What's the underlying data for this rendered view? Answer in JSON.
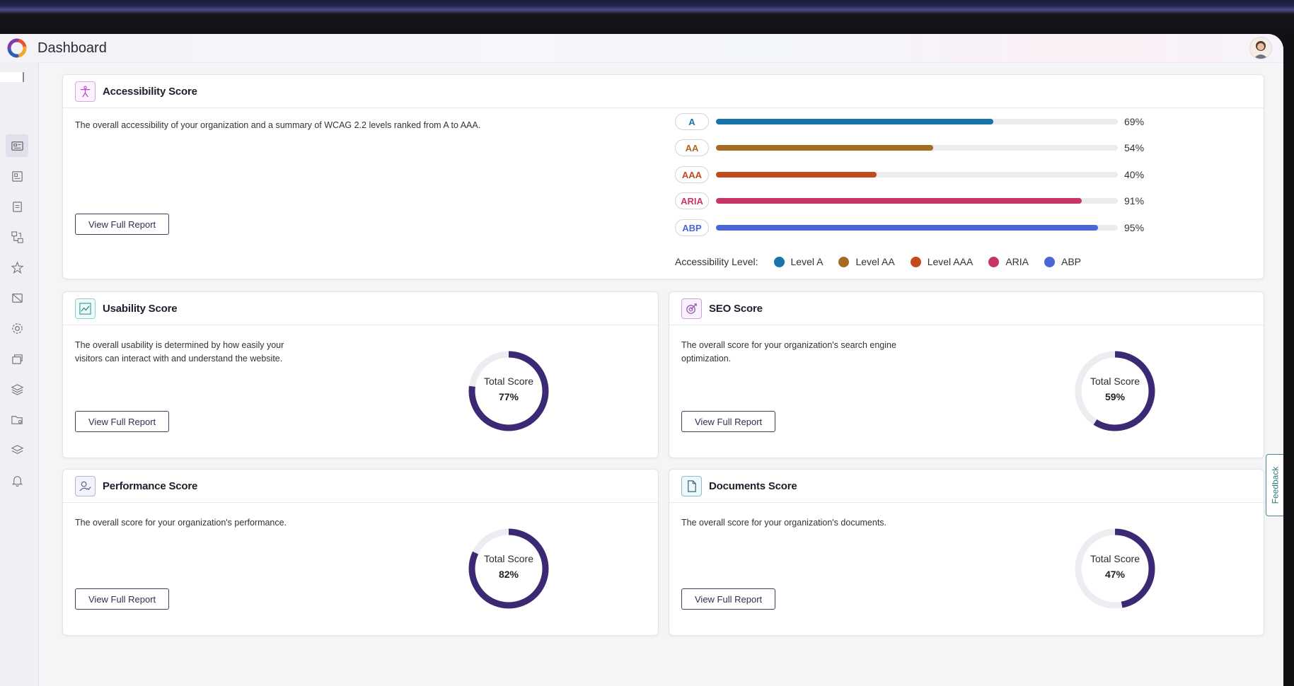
{
  "header": {
    "title": "Dashboard"
  },
  "sidebar": {
    "items": [
      {
        "icon": "dashboard-icon",
        "active": true
      },
      {
        "icon": "report-icon"
      },
      {
        "icon": "document-icon"
      },
      {
        "icon": "workflow-icon"
      },
      {
        "icon": "accessibility-icon"
      },
      {
        "icon": "image-off-icon"
      },
      {
        "icon": "gear-icon"
      },
      {
        "icon": "windows-icon"
      },
      {
        "icon": "layers-icon"
      },
      {
        "icon": "folder-settings-icon"
      },
      {
        "icon": "stack-icon"
      },
      {
        "icon": "bell-icon"
      }
    ]
  },
  "accessibility": {
    "title": "Accessibility Score",
    "description": "The overall accessibility of your organization and a summary of WCAG 2.2 levels ranked from A to AAA.",
    "button": "View Full Report",
    "levels": [
      {
        "label": "A",
        "percent_text": "69%",
        "value": 69,
        "color": "#1874a9"
      },
      {
        "label": "AA",
        "percent_text": "54%",
        "value": 54,
        "color": "#a86a22"
      },
      {
        "label": "AAA",
        "percent_text": "40%",
        "value": 40,
        "color": "#c24a1c"
      },
      {
        "label": "ARIA",
        "percent_text": "91%",
        "value": 91,
        "color": "#c93467"
      },
      {
        "label": "ABP",
        "percent_text": "95%",
        "value": 95,
        "color": "#4a67d6"
      }
    ],
    "legend_title": "Accessibility Level:",
    "legend": [
      {
        "label": "Level A",
        "color": "#1874a9"
      },
      {
        "label": "Level AA",
        "color": "#a86a22"
      },
      {
        "label": "Level AAA",
        "color": "#c24a1c"
      },
      {
        "label": "ARIA",
        "color": "#c93467"
      },
      {
        "label": "ABP",
        "color": "#4a67d6"
      }
    ]
  },
  "usability": {
    "title": "Usability Score",
    "description_line1": "The overall usability is determined by how easily your",
    "description_line2": "visitors can interact with and understand the website.",
    "button": "View Full Report",
    "score_label": "Total Score",
    "score_text": "77%",
    "score": 77
  },
  "seo": {
    "title": "SEO Score",
    "description_line1": "The overall score for your organization's search engine",
    "description_line2": "optimization.",
    "button": "View Full Report",
    "score_label": "Total Score",
    "score_text": "59%",
    "score": 59
  },
  "performance": {
    "title": "Performance Score",
    "description": "The overall score for your organization's performance.",
    "button": "View Full Report",
    "score_label": "Total Score",
    "score_text": "82%",
    "score": 82
  },
  "documents": {
    "title": "Documents Score",
    "description": "The overall score for your organization's documents.",
    "button": "View Full Report",
    "score_label": "Total Score",
    "score_text": "47%",
    "score": 47
  },
  "feedback": {
    "label": "Feedback"
  },
  "colors": {
    "donut_fill": "#3b2a73",
    "donut_track": "#ececf1"
  }
}
